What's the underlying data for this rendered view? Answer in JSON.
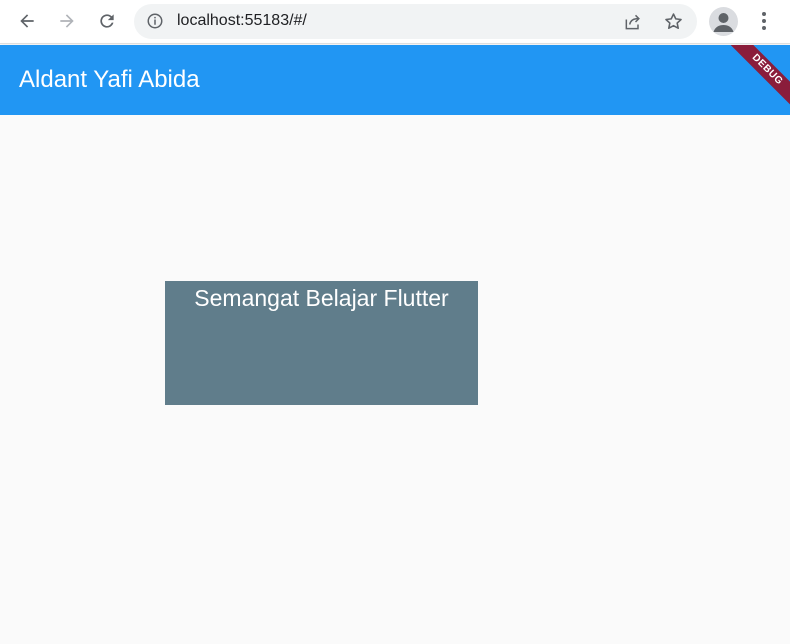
{
  "browser": {
    "url": "localhost:55183/#/",
    "icons": {
      "back": "arrow-left-icon",
      "forward": "arrow-right-icon",
      "reload": "reload-icon",
      "info": "info-icon",
      "share": "share-icon",
      "bookmark": "star-icon",
      "profile": "person-icon",
      "menu": "more-vert-icon"
    }
  },
  "app": {
    "title": "Aldant Yafi Abida",
    "debug_banner": "DEBUG",
    "colors": {
      "app_bar": "#2196f3",
      "box": "#607d8b",
      "banner": "#8a1d3b",
      "background": "#fafafa"
    }
  },
  "content": {
    "box_text": "Semangat Belajar Flutter"
  }
}
